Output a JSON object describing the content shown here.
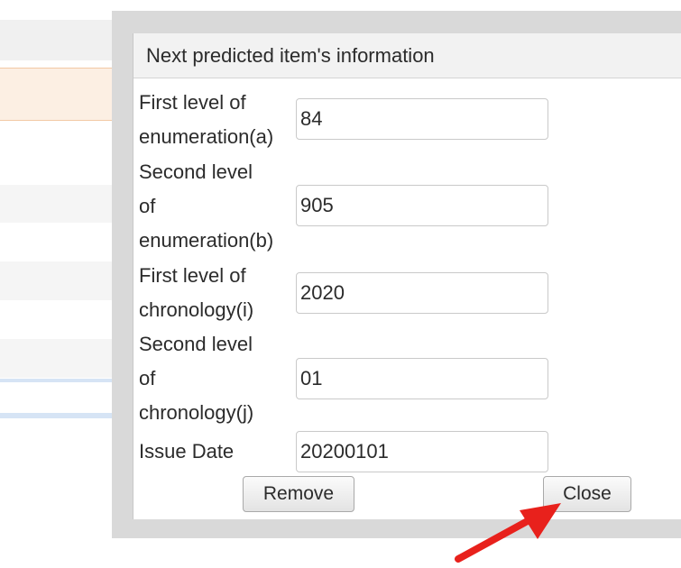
{
  "dialog": {
    "title": "Next predicted item's information",
    "fields": [
      {
        "label": "First level of\nenumeration(a)",
        "value": "84"
      },
      {
        "label": "Second level\nof\nenumeration(b)",
        "value": "905"
      },
      {
        "label": "First level of\nchronology(i)",
        "value": "2020"
      },
      {
        "label": "Second level\nof\nchronology(j)",
        "value": "01"
      },
      {
        "label": "Issue Date",
        "value": "20200101"
      }
    ],
    "remove_label": "Remove",
    "close_label": "Close"
  },
  "annotation": {
    "arrow_color": "#e8211c",
    "arrow_target": "close-button"
  }
}
